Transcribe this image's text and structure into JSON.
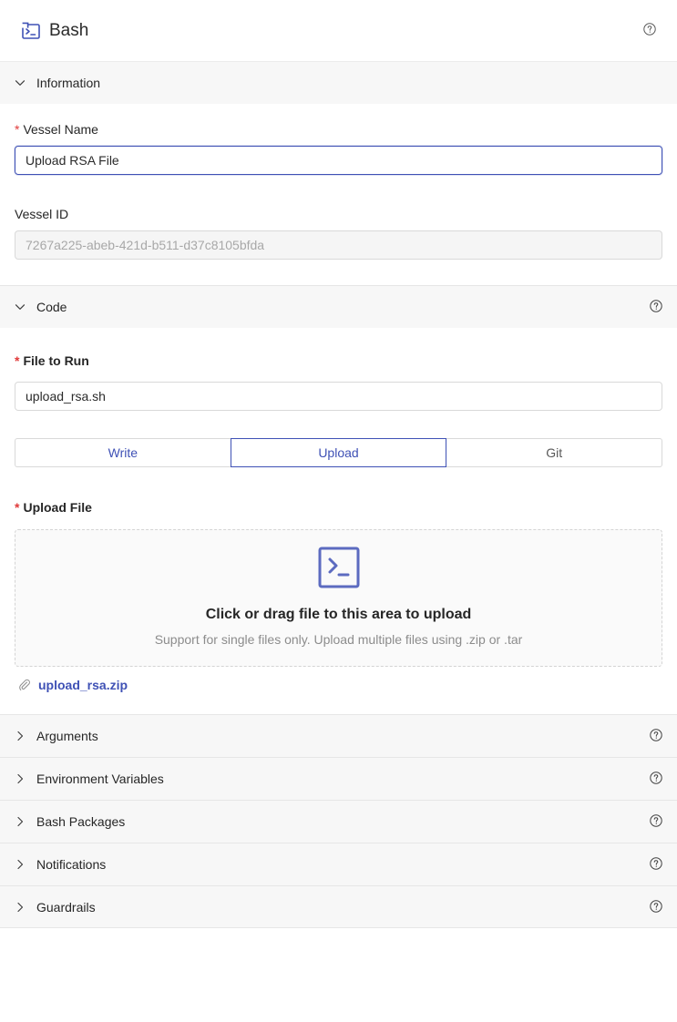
{
  "header": {
    "title": "Bash",
    "app_icon": "terminal-icon",
    "help_icon": "question-circle-icon"
  },
  "information": {
    "title": "Information",
    "vessel_name": {
      "label": "Vessel Name",
      "value": "Upload RSA File"
    },
    "vessel_id": {
      "label": "Vessel ID",
      "value": "7267a225-abeb-421d-b511-d37c8105bfda"
    }
  },
  "code": {
    "title": "Code",
    "file_to_run": {
      "label": "File to Run",
      "value": "upload_rsa.sh"
    },
    "tabs": [
      {
        "label": "Write"
      },
      {
        "label": "Upload"
      },
      {
        "label": "Git"
      }
    ],
    "active_tab": "Upload",
    "upload": {
      "label": "Upload File",
      "title": "Click or drag file to this area to upload",
      "hint": "Support for single files only. Upload multiple files using .zip or .tar",
      "file_name": "upload_rsa.zip"
    }
  },
  "collapsed_sections": [
    {
      "label": "Arguments"
    },
    {
      "label": "Environment Variables"
    },
    {
      "label": "Bash Packages"
    },
    {
      "label": "Notifications"
    },
    {
      "label": "Guardrails"
    }
  ],
  "colors": {
    "accent": "#3f51b5",
    "required": "#e03a3a",
    "section_bg": "#f7f7f7",
    "muted": "#8c8c8c"
  }
}
